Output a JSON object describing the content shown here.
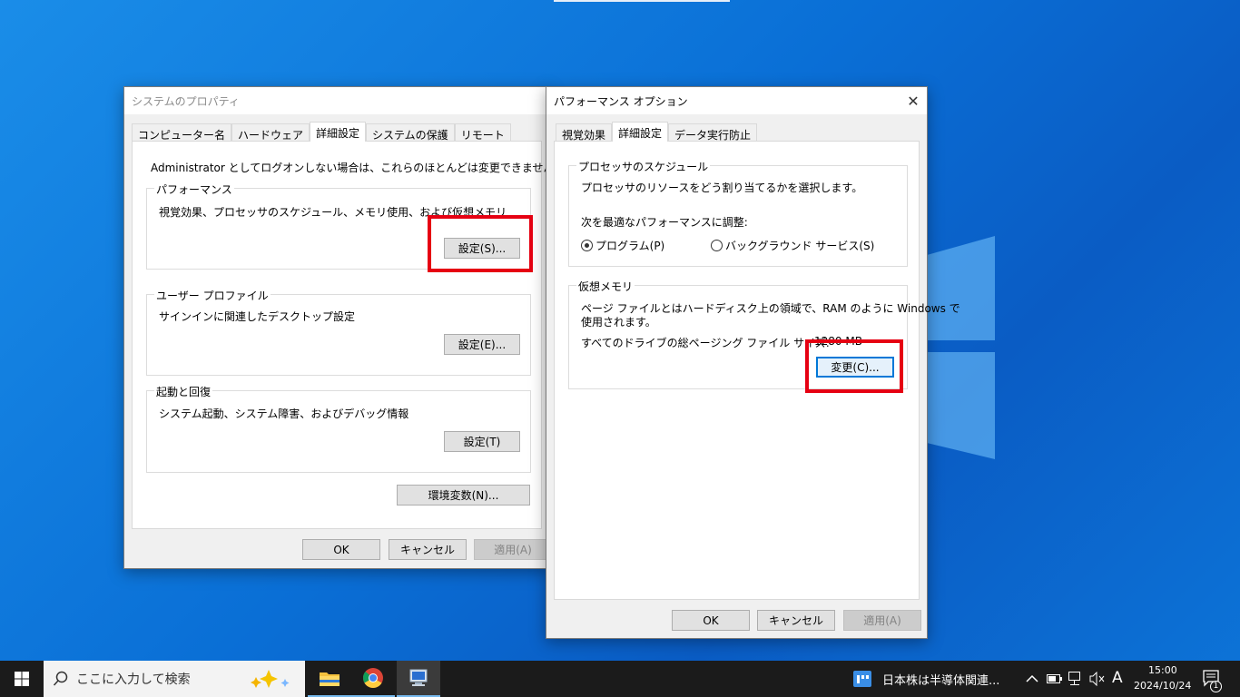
{
  "sysprops": {
    "title": "システムのプロパティ",
    "tabs": [
      "コンピューター名",
      "ハードウェア",
      "詳細設定",
      "システムの保護",
      "リモート"
    ],
    "notice": "Administrator としてログオンしない場合は、これらのほとんどは変更できません。",
    "performance": {
      "label": "パフォーマンス",
      "desc": "視覚効果、プロセッサのスケジュール、メモリ使用、および仮想メモリ",
      "button": "設定(S)..."
    },
    "user_profile": {
      "label": "ユーザー プロファイル",
      "desc": "サインインに関連したデスクトップ設定",
      "button": "設定(E)..."
    },
    "startup": {
      "label": "起動と回復",
      "desc": "システム起動、システム障害、およびデバッグ情報",
      "button": "設定(T)"
    },
    "env_button": "環境変数(N)...",
    "ok": "OK",
    "cancel": "キャンセル",
    "apply": "適用(A)"
  },
  "perfopts": {
    "title": "パフォーマンス オプション",
    "close": "✕",
    "tabs": [
      "視覚効果",
      "詳細設定",
      "データ実行防止"
    ],
    "scheduling": {
      "label": "プロセッサのスケジュール",
      "desc": "プロセッサのリソースをどう割り当てるかを選択します。",
      "adjust": "次を最適なパフォーマンスに調整:",
      "opt_programs": "プログラム(P)",
      "opt_background": "バックグラウンド サービス(S)"
    },
    "virtual_memory": {
      "label": "仮想メモリ",
      "desc_line1": "ページ ファイルとはハードディスク上の領域で、RAM のように Windows で",
      "desc_line2": "使用されます。",
      "total_label": "すべてのドライブの総ページング ファイル サイズ:",
      "total_value": "1280 MB",
      "button": "変更(C)..."
    },
    "ok": "OK",
    "cancel": "キャンセル",
    "apply": "適用(A)"
  },
  "taskbar": {
    "search_placeholder": "ここに入力して検索",
    "news": "日本株は半導体関連...",
    "ime": "A",
    "time": "15:00",
    "date": "2024/10/24",
    "notif_count": "1"
  },
  "colors": {
    "highlight": "#e60012",
    "accent": "#0078d7"
  }
}
